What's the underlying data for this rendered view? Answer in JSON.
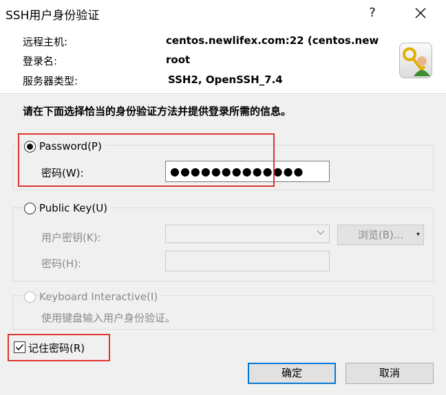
{
  "window": {
    "title": "SSH用户身份验证"
  },
  "info": {
    "host_label": "远程主机:",
    "host_value": "centos.newlifex.com:22 (centos.new",
    "login_label": "登录名:",
    "login_value": "root",
    "server_type_label": "服务器类型:",
    "server_type_value": "SSH2, OpenSSH_7.4"
  },
  "instruction": "请在下面选择恰当的身份验证方法并提供登录所需的信息。",
  "password_method": {
    "label": "Password(P)",
    "field_label": "密码(W):",
    "value_masked": "●●●●●●●●●●●●●"
  },
  "public_key_method": {
    "label": "Public Key(U)",
    "user_key_label": "用户密钥(K):",
    "browse_label": "浏览(B)...",
    "passphrase_label": "密码(H):"
  },
  "keyboard_interactive_method": {
    "label": "Keyboard Interactive(I)",
    "description": "使用键盘输入用户身份验证。"
  },
  "remember_password": {
    "label": "记住密码(R)",
    "checked": true
  },
  "buttons": {
    "ok": "确定",
    "cancel": "取消"
  },
  "colors": {
    "highlight": "#e0332e",
    "focus": "#0078d7"
  }
}
